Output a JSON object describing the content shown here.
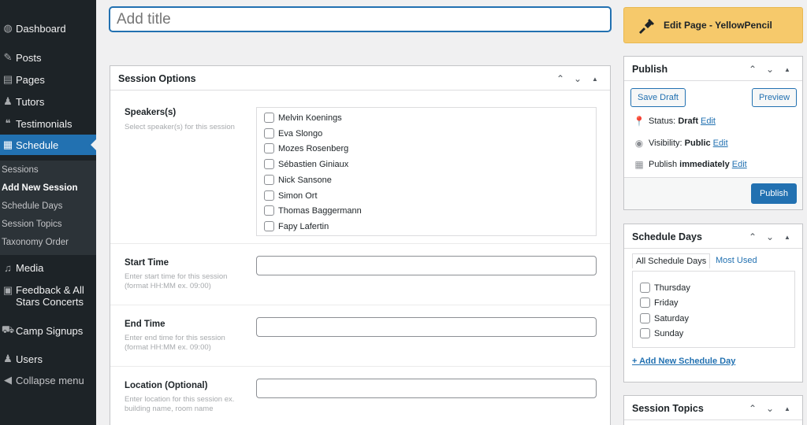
{
  "sidebar": {
    "items": [
      {
        "icon": "dashboard-icon",
        "glyph": "◍",
        "label": "Dashboard"
      },
      {
        "icon": "pin-icon",
        "glyph": "✎",
        "label": "Posts"
      },
      {
        "icon": "pages-icon",
        "glyph": "▤",
        "label": "Pages"
      },
      {
        "icon": "tutors-icon",
        "glyph": "♟",
        "label": "Tutors"
      },
      {
        "icon": "quote-icon",
        "glyph": "❝",
        "label": "Testimonials"
      },
      {
        "icon": "calendar-icon",
        "glyph": "▦",
        "label": "Schedule"
      }
    ],
    "submenu": [
      "Sessions",
      "Add New Session",
      "Schedule Days",
      "Session Topics",
      "Taxonomy Order"
    ],
    "items2": [
      {
        "icon": "media-icon",
        "glyph": "♫",
        "label": "Media"
      },
      {
        "icon": "feedback-icon",
        "glyph": "▣",
        "label": "Feedback & All Stars Concerts"
      },
      {
        "icon": "cart-icon",
        "glyph": "⛟",
        "label": "Camp Signups"
      },
      {
        "icon": "users-icon",
        "glyph": "♟",
        "label": "Users"
      },
      {
        "icon": "collapse-icon",
        "glyph": "◀",
        "label": "Collapse menu"
      }
    ]
  },
  "title_placeholder": "Add title",
  "session_options": {
    "title": "Session Options",
    "speakers": {
      "label": "Speakers(s)",
      "desc": "Select speaker(s) for this session",
      "names": [
        "Melvin Koenings",
        "Eva Slongo",
        "Mozes Rosenberg",
        "Sébastien Giniaux",
        "Nick Sansone",
        "Simon Ort",
        "Thomas Baggermann",
        "Fapy Lafertin"
      ]
    },
    "start_time": {
      "label": "Start Time",
      "desc": "Enter start time for this session (format HH:MM ex. 09:00)"
    },
    "end_time": {
      "label": "End Time",
      "desc": "Enter end time for this session (format HH:MM ex. 09:00)"
    },
    "location": {
      "label": "Location (Optional)",
      "desc": "Enter location for this session ex. building name, room name"
    }
  },
  "yellowpencil": {
    "label": "Edit Page - YellowPencil"
  },
  "publish": {
    "title": "Publish",
    "save_draft": "Save Draft",
    "preview": "Preview",
    "status_label": "Status:",
    "status_value": "Draft",
    "visibility_label": "Visibility:",
    "visibility_value": "Public",
    "publish_label": "Publish",
    "publish_value": "immediately",
    "edit": "Edit",
    "publish_button": "Publish"
  },
  "schedule_days": {
    "title": "Schedule Days",
    "tab_all": "All Schedule Days",
    "tab_used": "Most Used",
    "days": [
      "Thursday",
      "Friday",
      "Saturday",
      "Sunday"
    ],
    "add_link": "+ Add New Schedule Day"
  },
  "session_topics": {
    "title": "Session Topics"
  },
  "icons": {
    "up": "▲",
    "chevron_up": "⌃",
    "chevron_down": "⌄"
  },
  "colors": {
    "sidebar": "#1d2327",
    "accent": "#2271b1",
    "yellowpencil": "#f6c96b"
  }
}
